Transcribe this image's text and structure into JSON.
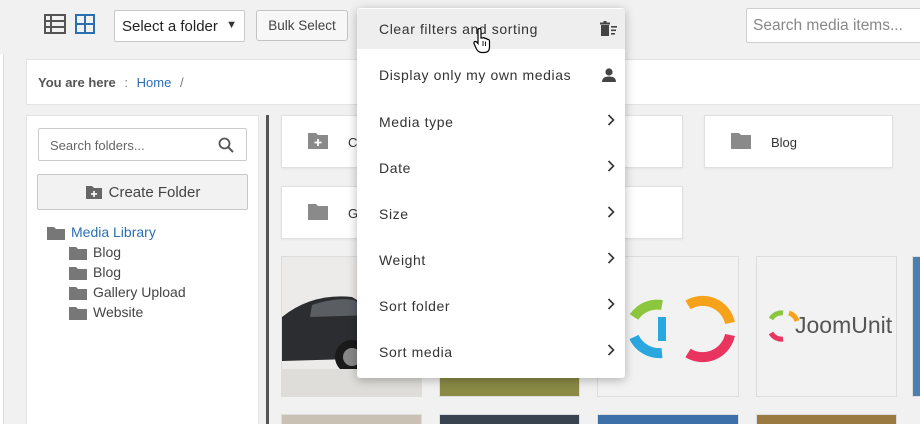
{
  "toolbar": {
    "folder_select_value": "Select a folder",
    "bulk_select_label": "Bulk Select",
    "search_placeholder": "Search media items..."
  },
  "breadcrumb": {
    "label": "You are here",
    "separator": ":",
    "home": "Home",
    "trail_separator": "/"
  },
  "sidebar": {
    "search_placeholder": "Search folders...",
    "create_folder_label": "Create Folder",
    "root": "Media Library",
    "children": [
      "Blog",
      "Blog",
      "Gallery Upload",
      "Website"
    ]
  },
  "folders": [
    {
      "label": "C"
    },
    {
      "label": "Blog"
    },
    {
      "label": "G"
    }
  ],
  "thumbnail_text": {
    "joomunited": "JoomUnit"
  },
  "filter_menu": {
    "items": [
      {
        "label": "Clear filters and sorting",
        "icon": "clear-filter-icon"
      },
      {
        "label": "Display only my own medias",
        "icon": "person-icon"
      },
      {
        "label": "Media type",
        "icon": "chevron-right-icon"
      },
      {
        "label": "Date",
        "icon": "chevron-right-icon"
      },
      {
        "label": "Size",
        "icon": "chevron-right-icon"
      },
      {
        "label": "Weight",
        "icon": "chevron-right-icon"
      },
      {
        "label": "Sort folder",
        "icon": "chevron-right-icon"
      },
      {
        "label": "Sort media",
        "icon": "chevron-right-icon"
      }
    ]
  },
  "colors": {
    "link": "#2b6fb3",
    "folder_icon": "#8a8a8a",
    "logo_green": "#8cc63f",
    "logo_orange": "#f7a21b",
    "logo_blue": "#2aa7df",
    "logo_pink": "#e8345e"
  }
}
